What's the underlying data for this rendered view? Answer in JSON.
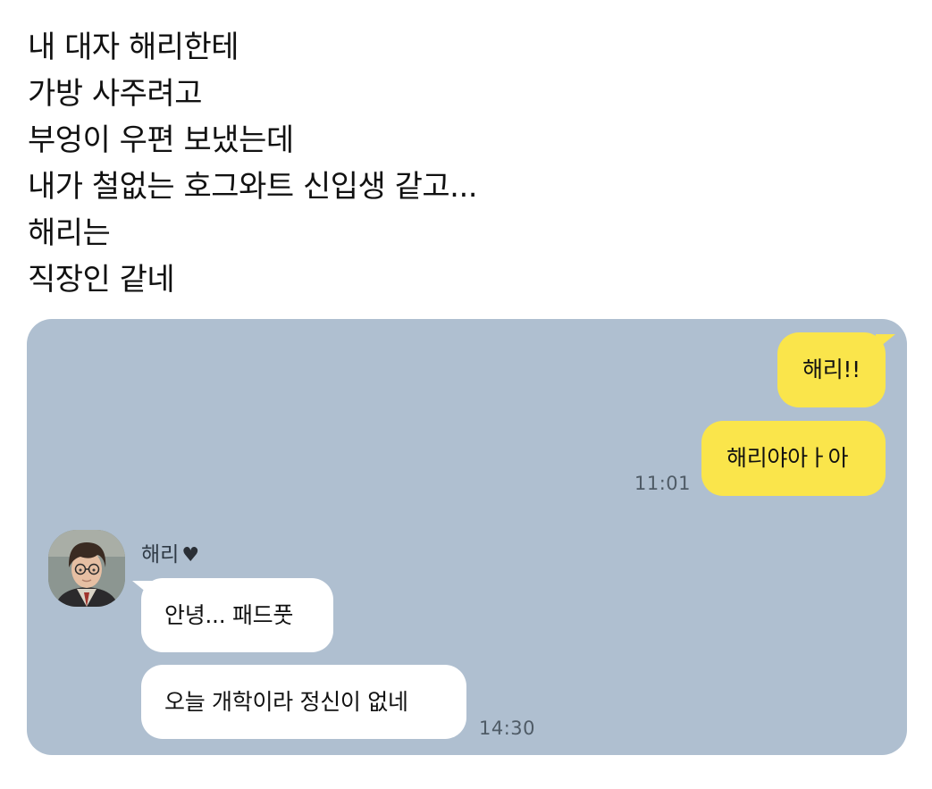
{
  "post": {
    "lines": [
      "내 대자 해리한테",
      "가방 사주려고",
      "부엉이 우편 보냈는데",
      "내가 철없는 호그와트 신입생 같고...",
      "해리는",
      "직장인 같네"
    ]
  },
  "chat": {
    "sent": [
      {
        "text": "해리!!"
      },
      {
        "text": "해리야아ㅏ아"
      }
    ],
    "sent_time": "11:01",
    "contact": {
      "name": "해리",
      "heart": "♥"
    },
    "received": [
      {
        "text": "안녕... 패드풋"
      },
      {
        "text": "오늘 개학이라 정신이 없네"
      }
    ],
    "received_time": "14:30",
    "colors": {
      "background": "#afbfd0",
      "sent_bubble": "#fae54b",
      "received_bubble": "#ffffff"
    }
  }
}
